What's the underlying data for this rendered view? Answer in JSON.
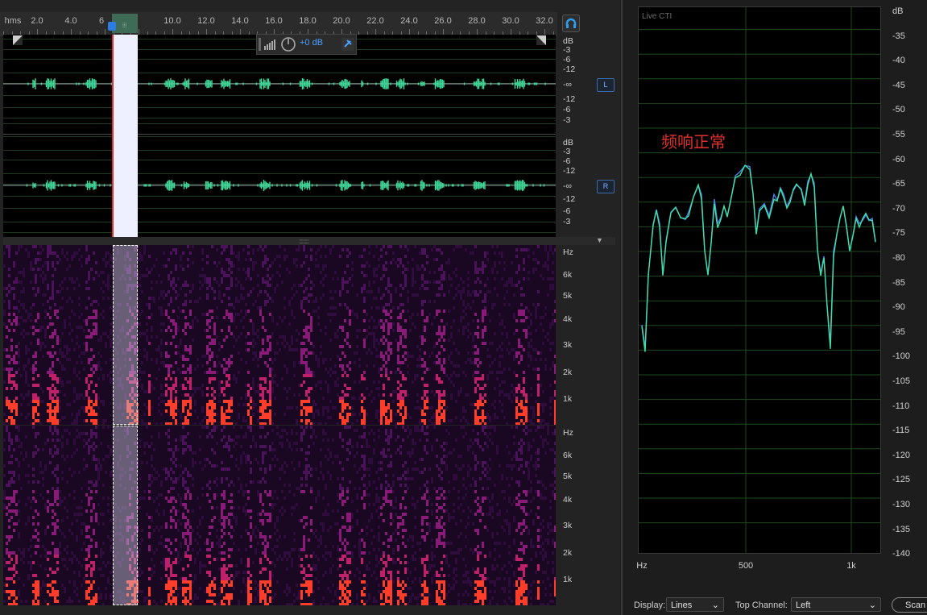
{
  "ruler": {
    "unit": "hms",
    "labels": [
      "2.0",
      "4.0",
      "6",
      "10.0",
      "12.0",
      "14.0",
      "16.0",
      "18.0",
      "20.0",
      "22.0",
      "24.0",
      "26.0",
      "28.0",
      "30.0",
      "32.0"
    ]
  },
  "waveform": {
    "db_scale_top": [
      "dB",
      "-3",
      "-6",
      "-12",
      "-∞",
      "-12",
      "-6",
      "-3"
    ],
    "db_scale_bottom": [
      "dB",
      "-3",
      "-6",
      "-12",
      "-∞",
      "-12",
      "-6",
      "-3"
    ],
    "left_channel_button": "L",
    "right_channel_button": "R",
    "hud_gain": "+0 dB",
    "waveform_color": "#3fd99a",
    "selection_color": "#eef0ff",
    "playhead_color": "#e03030"
  },
  "spectral": {
    "hz_labels": [
      "Hz",
      "6k",
      "5k",
      "4k",
      "3k",
      "2k",
      "1k"
    ]
  },
  "frequency_analysis": {
    "title": "Live CTI",
    "y_axis_labels": [
      "dB",
      "-35",
      "-40",
      "-45",
      "-50",
      "-55",
      "-60",
      "-65",
      "-70",
      "-75",
      "-80",
      "-85",
      "-90",
      "-95",
      "-100",
      "-105",
      "-110",
      "-115",
      "-120",
      "-125",
      "-130",
      "-135",
      "-140"
    ],
    "x_axis_labels": [
      "Hz",
      "500",
      "1k"
    ],
    "annotation": "频响正常",
    "series_colors": [
      "#4a82e8",
      "#3fe0a8"
    ],
    "display_label": "Display:",
    "display_value": "Lines",
    "top_channel_label": "Top Channel:",
    "top_channel_value": "Left",
    "scan_label": "Scan"
  }
}
